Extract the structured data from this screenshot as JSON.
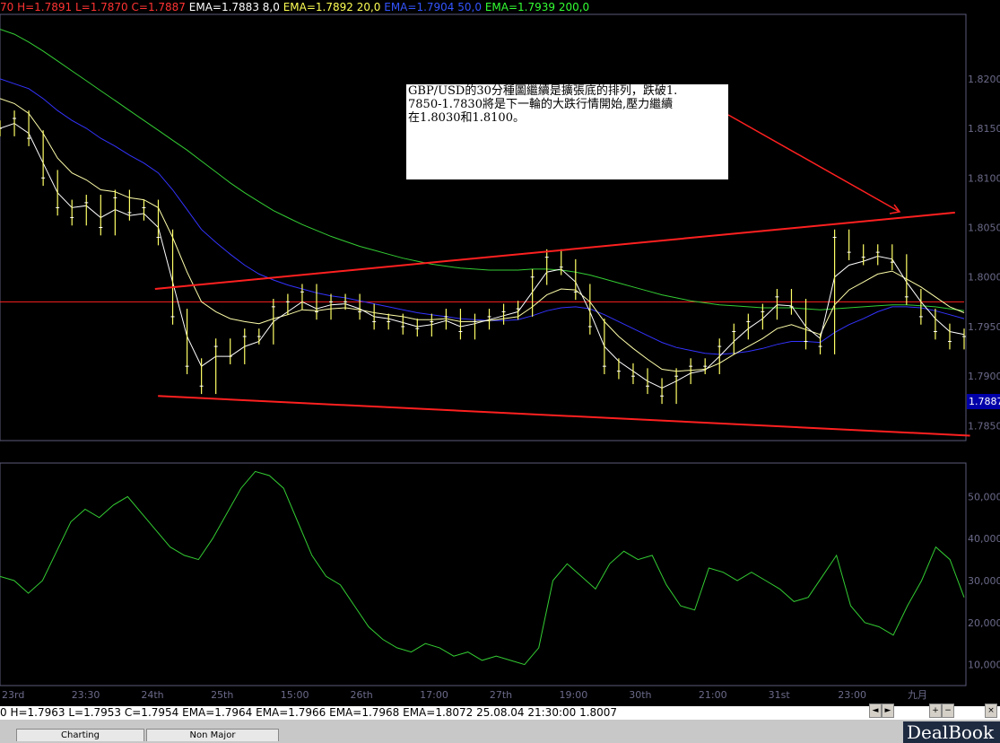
{
  "header": {
    "ohlc": "70 H=1.7891 L=1.7870 C=1.7887",
    "ema1": "EMA=1.7883  8,0",
    "ema2": "EMA=1.7892  20,0",
    "ema3": "EMA=1.7904  50,0",
    "ema4": "EMA=1.7939  200,0"
  },
  "colors": {
    "white": "#ffffff",
    "yellow": "#ffff66",
    "blue": "#3333ff",
    "green": "#33cc33",
    "red": "#ff2020",
    "ema8": "#ffffaa",
    "axis": "#6a6a8a"
  },
  "annotation": "GBP/USD的30分種圖繼續是擴張底的排列，跌破1.\n7850-1.7830將是下一輪的大跌行情開始,壓力繼續\n在1.8030和1.8100。",
  "price_axis": {
    "labels": [
      "1.8200",
      "1.8150",
      "1.8100",
      "1.8050",
      "1.8000",
      "1.7950",
      "1.7900",
      "1.7850"
    ],
    "current": "1.7887"
  },
  "osc_axis": {
    "labels": [
      "50,000",
      "40,000",
      "30,000",
      "20,000",
      "10,000"
    ]
  },
  "time_axis": {
    "labels": [
      "23rd",
      "23:30",
      "24th",
      "25th",
      "15:00",
      "26th",
      "17:00",
      "27th",
      "19:00",
      "30th",
      "21:00",
      "31st",
      "23:00",
      "九月"
    ]
  },
  "status_bar": "0 H=1.7963 L=1.7953 C=1.7954 EMA=1.7964 EMA=1.7966 EMA=1.7968 EMA=1.8072  25.08.04 21:30:00 1.8007",
  "tabs": [
    "Charting",
    "Non Major"
  ],
  "logo": "DealBook",
  "chart_data": {
    "type": "line",
    "price_ylim": [
      1.7835,
      1.8265
    ],
    "osc_ylim": [
      5,
      58
    ],
    "reference_level": 1.7975,
    "trendlines": [
      {
        "color": "red",
        "from": [
          0.155,
          1.7988
        ],
        "to": [
          0.955,
          1.8065
        ]
      },
      {
        "color": "red",
        "from": [
          0.158,
          1.788
        ],
        "to": [
          0.97,
          1.784
        ]
      }
    ],
    "price": [
      1.815,
      1.816,
      1.814,
      1.81,
      1.807,
      1.806,
      1.8075,
      1.805,
      1.808,
      1.8065,
      1.807,
      1.804,
      1.796,
      1.791,
      1.789,
      1.793,
      1.792,
      1.794,
      1.794,
      1.797,
      1.7975,
      1.7985,
      1.7965,
      1.7975,
      1.7975,
      1.7965,
      1.7955,
      1.7955,
      1.795,
      1.7948,
      1.7955,
      1.796,
      1.7945,
      1.7955,
      1.796,
      1.7965,
      1.7968,
      1.8,
      1.802,
      1.801,
      1.7985,
      1.795,
      1.791,
      1.7905,
      1.79,
      1.789,
      1.788,
      1.79,
      1.791,
      1.791,
      1.793,
      1.7945,
      1.7955,
      1.7965,
      1.798,
      1.797,
      1.7935,
      1.793,
      1.804,
      1.8025,
      1.802,
      1.8025,
      1.8015,
      1.798,
      1.796,
      1.7945,
      1.7935,
      1.794
    ],
    "ema8": [
      1.815,
      1.8155,
      1.8145,
      1.8115,
      1.8085,
      1.807,
      1.8072,
      1.806,
      1.8068,
      1.8062,
      1.8064,
      1.805,
      1.7995,
      1.794,
      1.791,
      1.792,
      1.792,
      1.793,
      1.7935,
      1.7955,
      1.7965,
      1.7975,
      1.7968,
      1.7972,
      1.7973,
      1.7968,
      1.796,
      1.7958,
      1.7954,
      1.795,
      1.7952,
      1.7956,
      1.795,
      1.7953,
      1.7957,
      1.7961,
      1.7965,
      1.7985,
      1.8005,
      1.8008,
      1.7995,
      1.7965,
      1.793,
      1.7915,
      1.7905,
      1.7895,
      1.7888,
      1.7895,
      1.7903,
      1.7906,
      1.792,
      1.7935,
      1.7948,
      1.7958,
      1.7972,
      1.7971,
      1.795,
      1.7938,
      1.8,
      1.8012,
      1.8016,
      1.8021,
      1.8018,
      1.7995,
      1.7975,
      1.7958,
      1.7945,
      1.7942
    ],
    "ema20": [
      1.818,
      1.8175,
      1.8165,
      1.8145,
      1.812,
      1.8105,
      1.8098,
      1.8088,
      1.8086,
      1.808,
      1.8078,
      1.807,
      1.804,
      1.8005,
      1.7975,
      1.7965,
      1.7958,
      1.7955,
      1.7953,
      1.7958,
      1.7962,
      1.7967,
      1.7966,
      1.7968,
      1.7969,
      1.7967,
      1.7964,
      1.7962,
      1.796,
      1.7957,
      1.7957,
      1.7958,
      1.7955,
      1.7955,
      1.7956,
      1.7958,
      1.796,
      1.797,
      1.7982,
      1.7988,
      1.7987,
      1.7975,
      1.7955,
      1.794,
      1.7928,
      1.7917,
      1.7907,
      1.7905,
      1.7906,
      1.7907,
      1.7913,
      1.7922,
      1.793,
      1.7938,
      1.7948,
      1.7952,
      1.7947,
      1.7942,
      1.7972,
      1.7987,
      1.7995,
      1.8003,
      1.8006,
      1.7998,
      1.799,
      1.798,
      1.797,
      1.7964
    ],
    "ema50": [
      1.82,
      1.8195,
      1.819,
      1.818,
      1.8168,
      1.8158,
      1.815,
      1.814,
      1.8132,
      1.8123,
      1.8115,
      1.8105,
      1.8088,
      1.8068,
      1.8048,
      1.8035,
      1.8023,
      1.8012,
      1.8003,
      1.7997,
      1.7992,
      1.7988,
      1.7984,
      1.7981,
      1.7979,
      1.7976,
      1.7973,
      1.797,
      1.7967,
      1.7964,
      1.7962,
      1.796,
      1.7958,
      1.7957,
      1.7956,
      1.7956,
      1.7957,
      1.7961,
      1.7966,
      1.7969,
      1.797,
      1.7968,
      1.7962,
      1.7955,
      1.7948,
      1.7941,
      1.7934,
      1.7929,
      1.7926,
      1.7923,
      1.7922,
      1.7923,
      1.7925,
      1.7928,
      1.7932,
      1.7935,
      1.7935,
      1.7934,
      1.7944,
      1.7952,
      1.7958,
      1.7965,
      1.797,
      1.797,
      1.7969,
      1.7966,
      1.7962,
      1.7958
    ],
    "ema200": [
      1.825,
      1.8245,
      1.8237,
      1.8228,
      1.8218,
      1.8208,
      1.8198,
      1.8188,
      1.8178,
      1.8168,
      1.8158,
      1.8148,
      1.8138,
      1.8128,
      1.8117,
      1.8106,
      1.8095,
      1.8085,
      1.8076,
      1.8067,
      1.806,
      1.8053,
      1.8047,
      1.8041,
      1.8036,
      1.8031,
      1.8027,
      1.8023,
      1.8019,
      1.8016,
      1.8013,
      1.8011,
      1.8009,
      1.8008,
      1.8007,
      1.8007,
      1.8007,
      1.8008,
      1.8008,
      1.8007,
      1.8005,
      1.8002,
      1.7998,
      1.7994,
      1.799,
      1.7986,
      1.7982,
      1.7979,
      1.7976,
      1.7974,
      1.7972,
      1.7971,
      1.797,
      1.7969,
      1.7969,
      1.7969,
      1.7968,
      1.7967,
      1.7968,
      1.7969,
      1.797,
      1.7971,
      1.7972,
      1.7972,
      1.7971,
      1.797,
      1.7968,
      1.7966
    ],
    "oscillator": [
      31,
      30,
      27,
      30,
      37,
      44,
      47,
      45,
      48,
      50,
      46,
      42,
      38,
      36,
      35,
      40,
      46,
      52,
      56,
      55,
      52,
      44,
      36,
      31,
      29,
      24,
      19,
      16,
      14,
      13,
      15,
      14,
      12,
      13,
      11,
      12,
      11,
      10,
      14,
      30,
      34,
      31,
      28,
      34,
      37,
      35,
      36,
      29,
      24,
      23,
      33,
      32,
      30,
      32,
      30,
      28,
      25,
      26,
      31,
      36,
      24,
      20,
      19,
      17,
      24,
      30,
      38,
      35,
      26
    ]
  }
}
